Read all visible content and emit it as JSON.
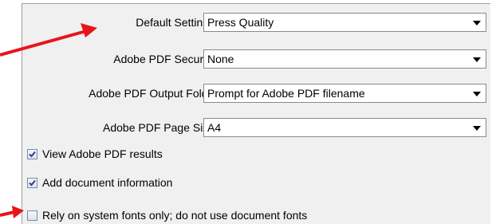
{
  "settings": {
    "default_settings": {
      "label": "Default Settings:",
      "value": "Press Quality"
    },
    "pdf_security": {
      "label": "Adobe PDF Security:",
      "value": "None"
    },
    "output_folder": {
      "label": "Adobe PDF Output Folder",
      "value": "Prompt for Adobe PDF filename"
    },
    "page_size": {
      "label": "Adobe PDF Page Size:",
      "value": "A4"
    }
  },
  "options": [
    {
      "label": "View Adobe PDF results",
      "checked": true
    },
    {
      "label": "Add document information",
      "checked": true
    },
    {
      "label": "Rely on system fonts only; do not use document fonts",
      "checked": false
    }
  ],
  "icons": {
    "dropdown": "chevron-down-icon",
    "checkmark": "checkmark-icon",
    "annotation": "red-arrow-icon"
  },
  "colors": {
    "annotation_arrow": "#e8141b",
    "panel_bg": "#f0f0f0",
    "checkmark": "#2a3f8c"
  }
}
